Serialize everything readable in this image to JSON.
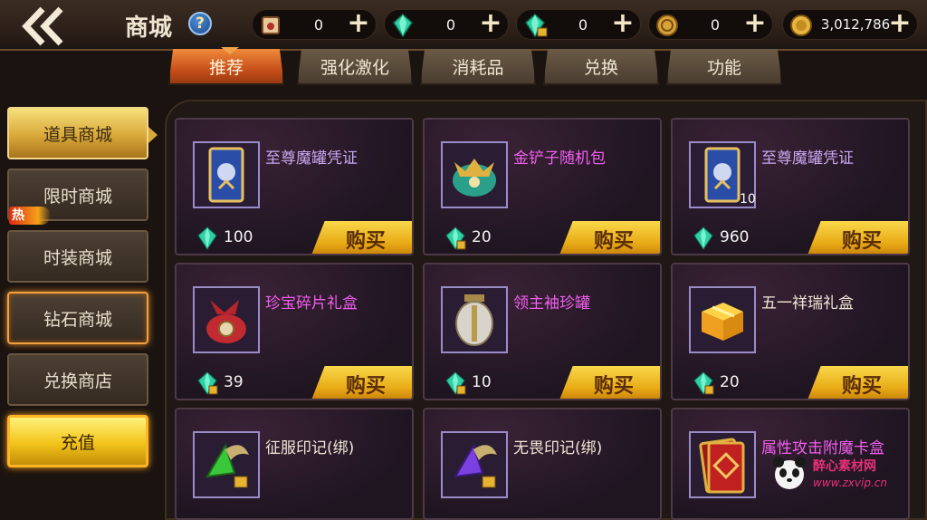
{
  "header": {
    "title": "商城",
    "help_label": "?",
    "resources": [
      {
        "icon": "scroll-icon",
        "value": "0"
      },
      {
        "icon": "diamond-icon",
        "value": "0"
      },
      {
        "icon": "locked-diamond-icon",
        "value": "0"
      },
      {
        "icon": "token-icon",
        "value": "0"
      },
      {
        "icon": "gold-coin-icon",
        "value": "3,012,786"
      }
    ],
    "plus_label": "+"
  },
  "tabs": [
    {
      "label": "推荐",
      "active": true
    },
    {
      "label": "强化激化",
      "active": false
    },
    {
      "label": "消耗品",
      "active": false
    },
    {
      "label": "兑换",
      "active": false
    },
    {
      "label": "功能",
      "active": false
    }
  ],
  "sidebar": {
    "items": [
      {
        "label": "道具商城",
        "active": true
      },
      {
        "label": "限时商城",
        "active": false,
        "badge": "热"
      },
      {
        "label": "时装商城",
        "active": false
      },
      {
        "label": "钻石商城",
        "active": false
      },
      {
        "label": "兑换商店",
        "active": false
      },
      {
        "label": "充值",
        "active": false
      }
    ]
  },
  "items": [
    {
      "name": "至尊魔罐凭证",
      "name_color": "#c9a6f0",
      "icon": "ticket-card-icon",
      "qty": "",
      "currency": "diamond",
      "price": "100",
      "buy": "购买"
    },
    {
      "name": "金铲子随机包",
      "name_color": "#f25ef0",
      "icon": "treasure-bag-icon",
      "qty": "",
      "currency": "locked-diamond",
      "price": "20",
      "buy": "购买"
    },
    {
      "name": "至尊魔罐凭证",
      "name_color": "#c9a6f0",
      "icon": "ticket-card-icon",
      "qty": "10",
      "currency": "diamond",
      "price": "960",
      "buy": "购买"
    },
    {
      "name": "珍宝碎片礼盒",
      "name_color": "#f25ef0",
      "icon": "red-gift-bag-icon",
      "qty": "",
      "currency": "locked-diamond",
      "price": "39",
      "buy": "购买"
    },
    {
      "name": "领主袖珍罐",
      "name_color": "#f25ef0",
      "icon": "jar-icon",
      "qty": "",
      "currency": "locked-diamond",
      "price": "10",
      "buy": "购买"
    },
    {
      "name": "五一祥瑞礼盒",
      "name_color": "#f0e6d6",
      "icon": "gold-giftbox-icon",
      "qty": "",
      "currency": "locked-diamond",
      "price": "20",
      "buy": "购买"
    },
    {
      "name": "征服印记(绑)",
      "name_color": "#f0e6d6",
      "icon": "green-gem-winged-icon",
      "qty": "",
      "currency": "",
      "price": "",
      "buy": ""
    },
    {
      "name": "无畏印记(绑)",
      "name_color": "#f0e6d6",
      "icon": "purple-gem-winged-icon",
      "qty": "",
      "currency": "",
      "price": "",
      "buy": ""
    },
    {
      "name": "属性攻击附魔卡盒",
      "name_color": "#f25ef0",
      "icon": "card-box-icon",
      "qty": "",
      "currency": "",
      "price": "",
      "buy": ""
    }
  ],
  "watermark": {
    "text": "醉心素材网",
    "url": "www.zxvip.cn"
  },
  "colors": {
    "accent_orange": "#e06a28",
    "gold": "#f2c41a",
    "card_bg": "#241826",
    "name_magenta": "#f25ef0"
  }
}
